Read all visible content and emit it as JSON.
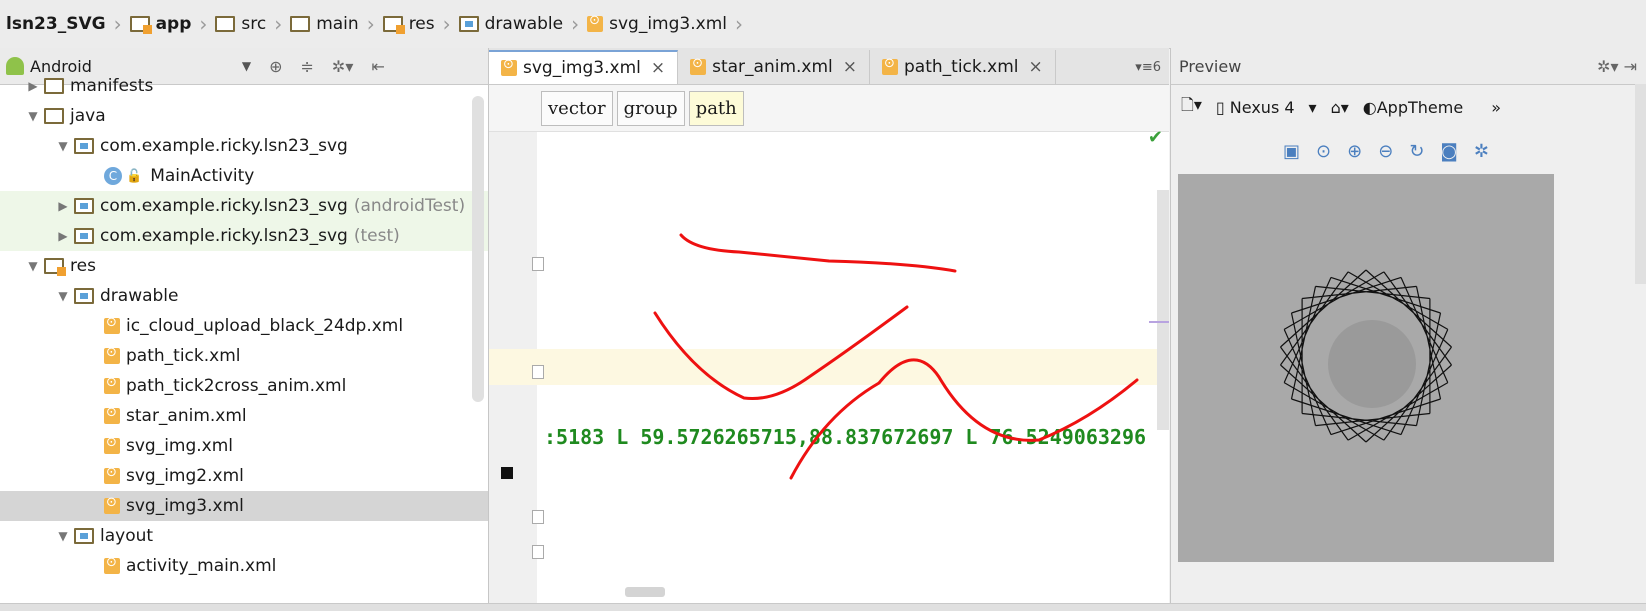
{
  "breadcrumb": [
    "lsn23_SVG",
    "app",
    "src",
    "main",
    "res",
    "drawable",
    "svg_img3.xml"
  ],
  "project_panel": {
    "view_label": "Android",
    "tree": [
      {
        "label": "manifests",
        "level": 1,
        "expanded": false,
        "type": "folder"
      },
      {
        "label": "java",
        "level": 1,
        "expanded": true,
        "type": "folder"
      },
      {
        "label": "com.example.ricky.lsn23_svg",
        "level": 2,
        "expanded": true,
        "type": "package"
      },
      {
        "label": "MainActivity",
        "level": 3,
        "type": "class"
      },
      {
        "label": "com.example.ricky.lsn23_svg",
        "suffix": "(androidTest)",
        "level": 2,
        "expanded": false,
        "type": "package",
        "tint": "green"
      },
      {
        "label": "com.example.ricky.lsn23_svg",
        "suffix": "(test)",
        "level": 2,
        "expanded": false,
        "type": "package",
        "tint": "green"
      },
      {
        "label": "res",
        "level": 1,
        "expanded": true,
        "type": "res"
      },
      {
        "label": "drawable",
        "level": 2,
        "expanded": true,
        "type": "package"
      },
      {
        "label": "ic_cloud_upload_black_24dp.xml",
        "level": 3,
        "type": "xml"
      },
      {
        "label": "path_tick.xml",
        "level": 3,
        "type": "xml"
      },
      {
        "label": "path_tick2cross_anim.xml",
        "level": 3,
        "type": "xml"
      },
      {
        "label": "star_anim.xml",
        "level": 3,
        "type": "xml"
      },
      {
        "label": "svg_img.xml",
        "level": 3,
        "type": "xml"
      },
      {
        "label": "svg_img2.xml",
        "level": 3,
        "type": "xml"
      },
      {
        "label": "svg_img3.xml",
        "level": 3,
        "type": "xml",
        "selected": true
      },
      {
        "label": "layout",
        "level": 2,
        "expanded": true,
        "type": "package"
      },
      {
        "label": "activity_main.xml",
        "level": 3,
        "type": "xml"
      }
    ]
  },
  "editor": {
    "tabs": [
      {
        "label": "svg_img3.xml",
        "active": true
      },
      {
        "label": "star_anim.xml",
        "active": false
      },
      {
        "label": "path_tick.xml",
        "active": false
      }
    ],
    "tabs_more": "≡6",
    "tag_crumbs": [
      "vector",
      "group",
      "path"
    ],
    "code_line": ":5183 L 59.5726265715,88.837672697 L 76.5249063296"
  },
  "preview": {
    "title": "Preview",
    "device": "Nexus 4",
    "theme": "AppTheme",
    "more": "»",
    "zoom_label": "1:1"
  },
  "colors": {
    "annotation_red": "#ee1111",
    "code_green": "#1f8a1f",
    "preview_bg": "#a9a9a9"
  }
}
